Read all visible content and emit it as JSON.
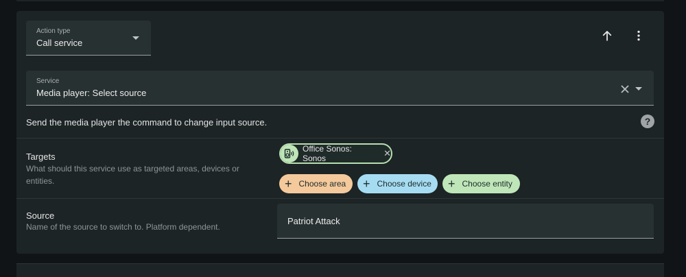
{
  "action_type": {
    "label": "Action type",
    "value": "Call service"
  },
  "service": {
    "label": "Service",
    "value": "Media player: Select source"
  },
  "description": "Send the media player the command to change input source.",
  "help_glyph": "?",
  "targets": {
    "title": "Targets",
    "description": "What should this service use as targeted areas, devices or entities.",
    "selected": {
      "label": "Office Sonos: Sonos",
      "icon": "speaker-icon"
    },
    "add_buttons": [
      {
        "label": "Choose area",
        "color": "#f4c99c"
      },
      {
        "label": "Choose device",
        "color": "#a6dcf2"
      },
      {
        "label": "Choose entity",
        "color": "#bfe6b8"
      }
    ]
  },
  "source": {
    "title": "Source",
    "description": "Name of the source to switch to. Platform dependent.",
    "value": "Patriot Attack"
  },
  "colors": {
    "card": "#1c2425",
    "field": "#283132",
    "background": "#111416"
  }
}
